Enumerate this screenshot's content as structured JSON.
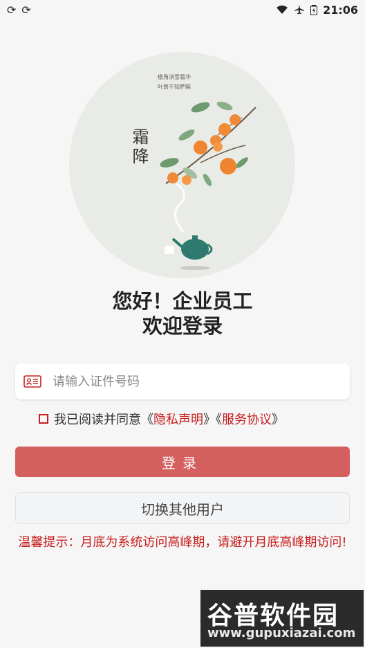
{
  "status": {
    "time": "21:06",
    "left_icons": [
      "sync-icon",
      "sync-icon"
    ],
    "right_icons": [
      "wifi-icon",
      "airplane-icon",
      "battery-icon"
    ]
  },
  "hero": {
    "poem_line1": "檐角浙雪霜华",
    "poem_line2": "叶黄不知萨黯",
    "season": "霜降"
  },
  "greeting": {
    "line1": "您好！企业员工",
    "line2": "欢迎登录"
  },
  "id_input": {
    "placeholder": "请输入证件号码",
    "value": ""
  },
  "agreement": {
    "checked": false,
    "prefix": "我已阅读并同意《",
    "privacy": "隐私声明",
    "mid": "》《",
    "service": "服务协议",
    "suffix": "》"
  },
  "buttons": {
    "login": "登录",
    "switch_user": "切换其他用户"
  },
  "tips": "温馨提示：月底为系统访问高峰期，请避开月底高峰期访问!",
  "watermark": {
    "brand": "谷普软件园",
    "url": "www.gupuxiazai.com"
  },
  "colors": {
    "accent_red": "#c81e1e",
    "login_button": "#d45f5f",
    "hero_bg": "#e9ebe6"
  }
}
